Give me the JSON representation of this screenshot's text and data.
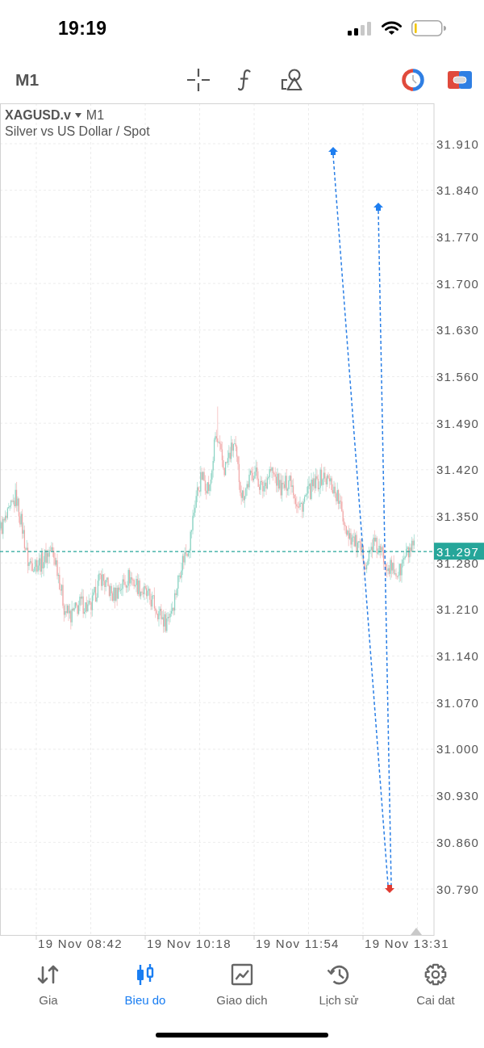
{
  "status_bar": {
    "time": "19:19"
  },
  "toolbar": {
    "timeframe": "M1"
  },
  "chart": {
    "symbol": "XAGUSD.v",
    "timeframe": "M1",
    "description": "Silver vs US Dollar / Spot",
    "price_labels": [
      "31.910",
      "31.840",
      "31.770",
      "31.700",
      "31.630",
      "31.560",
      "31.490",
      "31.420",
      "31.350",
      "31.280",
      "31.210",
      "31.140",
      "31.070",
      "31.000",
      "30.930",
      "30.860",
      "30.790"
    ],
    "current_price": "31.297",
    "time_labels": [
      "19 Nov 08:42",
      "19 Nov 10:18",
      "19 Nov 11:54",
      "19 Nov 13:31"
    ]
  },
  "tab_bar": [
    {
      "label": "Gia",
      "selected": false
    },
    {
      "label": "Bieu do",
      "selected": true
    },
    {
      "label": "Giao dich",
      "selected": false
    },
    {
      "label": "Lịch sử",
      "selected": false
    },
    {
      "label": "Cai dat",
      "selected": false
    }
  ]
}
